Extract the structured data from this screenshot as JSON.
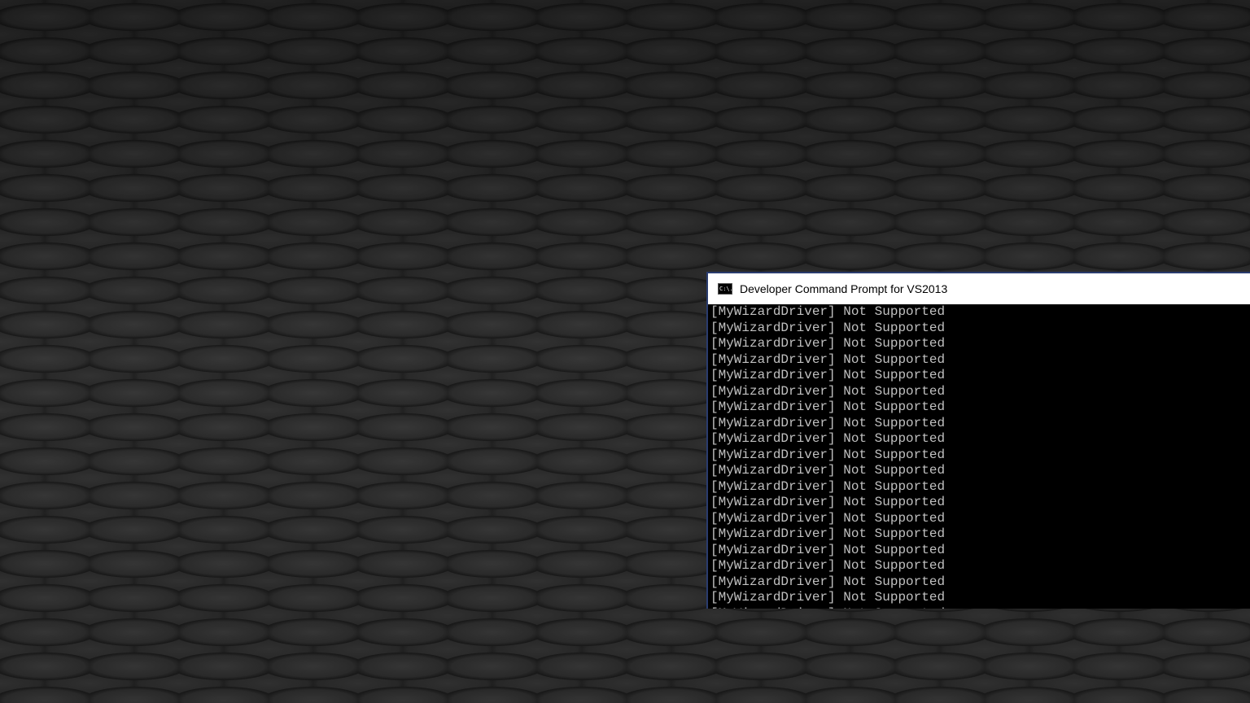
{
  "window": {
    "title": "Developer Command Prompt for VS2013",
    "icon": "cmd-icon",
    "icon_text": "C:\\."
  },
  "console": {
    "lines": [
      "[MyWizardDriver] Not Supported",
      "[MyWizardDriver] Not Supported",
      "[MyWizardDriver] Not Supported",
      "[MyWizardDriver] Not Supported",
      "[MyWizardDriver] Not Supported",
      "[MyWizardDriver] Not Supported",
      "[MyWizardDriver] Not Supported",
      "[MyWizardDriver] Not Supported",
      "[MyWizardDriver] Not Supported",
      "[MyWizardDriver] Not Supported",
      "[MyWizardDriver] Not Supported",
      "[MyWizardDriver] Not Supported",
      "[MyWizardDriver] Not Supported",
      "[MyWizardDriver] Not Supported",
      "[MyWizardDriver] Not Supported",
      "[MyWizardDriver] Not Supported",
      "[MyWizardDriver] Not Supported",
      "[MyWizardDriver] Not Supported",
      "[MyWizardDriver] Not Supported",
      "[MyWizardDriver] Not Supported"
    ]
  },
  "colors": {
    "console_background": "#000000",
    "console_text": "#c0c0c0",
    "title_bar": "#ffffff",
    "window_border": "#2a3c6e"
  }
}
